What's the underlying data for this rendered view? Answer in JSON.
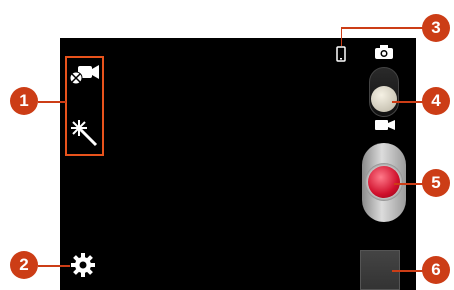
{
  "callouts": [
    {
      "number": "1",
      "color": "#cc3d16"
    },
    {
      "number": "2",
      "color": "#cc3d16"
    },
    {
      "number": "3",
      "color": "#cc3d16"
    },
    {
      "number": "4",
      "color": "#cc3d16"
    },
    {
      "number": "5",
      "color": "#cc3d16"
    },
    {
      "number": "6",
      "color": "#cc3d16"
    }
  ],
  "icons": {
    "shortcut_recording_mode": "video-camera-icon",
    "shortcut_effects": "magic-wand-icon",
    "settings": "gear-icon",
    "storage": "phone-storage-icon",
    "camera_mode": "camera-icon",
    "video_mode": "video-camera-icon"
  },
  "colors": {
    "accent": "#cc3d16",
    "viewfinder": "#000000",
    "shutter": "#d0102c"
  }
}
